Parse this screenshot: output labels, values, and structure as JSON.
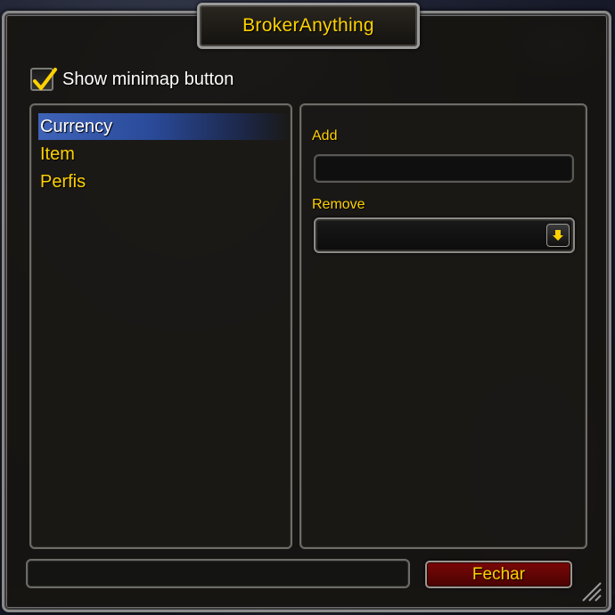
{
  "window": {
    "title": "BrokerAnything",
    "show_minimap_label": "Show minimap button",
    "show_minimap_checked": true
  },
  "tree": {
    "items": [
      {
        "label": "Currency",
        "selected": true
      },
      {
        "label": "Item",
        "selected": false
      },
      {
        "label": "Perfis",
        "selected": false
      }
    ]
  },
  "options": {
    "add_label": "Add",
    "add_value": "",
    "remove_label": "Remove",
    "remove_value": ""
  },
  "footer": {
    "status_text": "",
    "close_label": "Fechar"
  },
  "colors": {
    "title_gold": "#ffd100",
    "selection_blue": "#3e63b8",
    "close_button_red": "#7a0707"
  },
  "icons": {
    "checkbox_mark": "check-icon",
    "dropdown": "chevron-down-icon",
    "resize": "resize-grip-icon"
  }
}
